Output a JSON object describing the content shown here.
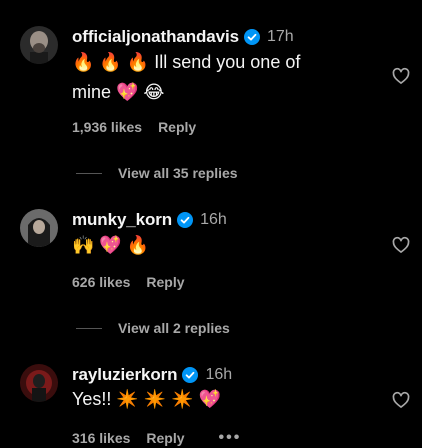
{
  "colors": {
    "background": "#000000",
    "text_primary": "#f5f5f5",
    "text_secondary": "#a8a8a8",
    "verified_badge": "#0095f6"
  },
  "comments": [
    {
      "username": "officialjonathandavis",
      "verified": true,
      "time": "17h",
      "text_line1": "🔥 🔥 🔥 Ill send you one of",
      "text_line2": "mine 💖 😂",
      "likes": "1,936 likes",
      "reply_label": "Reply",
      "view_replies": "View all 35 replies",
      "avatar_icon": "avatar-bald-man"
    },
    {
      "username": "munky_korn",
      "verified": true,
      "time": "16h",
      "text_line1": "🙌 💖 🔥",
      "likes": "626 likes",
      "reply_label": "Reply",
      "view_replies": "View all 2 replies",
      "avatar_icon": "avatar-long-hair-man"
    },
    {
      "username": "rayluzierkorn",
      "verified": true,
      "time": "16h",
      "text_line1": "Yes!! ✴️ ✴️ ✴️ 💖",
      "likes": "316 likes",
      "reply_label": "Reply",
      "more_label": "•••",
      "avatar_icon": "avatar-red-artwork"
    }
  ]
}
